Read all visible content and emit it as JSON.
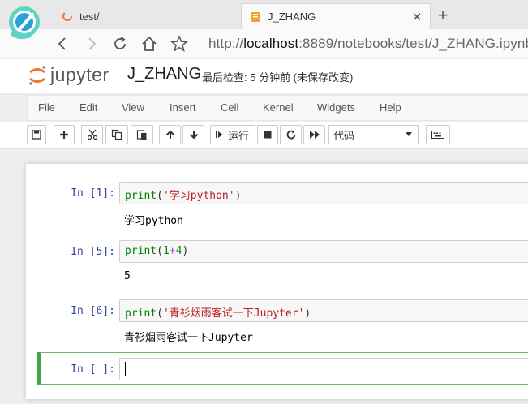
{
  "browser": {
    "tabs": [
      {
        "title": "test/",
        "active": false
      },
      {
        "title": "J_ZHANG",
        "active": true
      }
    ],
    "url": {
      "scheme": "http://",
      "host": "localhost",
      "rest": ":8889/notebooks/test/J_ZHANG.ipynb"
    }
  },
  "jupyter": {
    "logo_text": "jupyter",
    "notebook_name": "J_ZHANG",
    "checkpoint": "最后检查: 5 分钟前  (未保存改变)"
  },
  "menu": [
    "File",
    "Edit",
    "View",
    "Insert",
    "Cell",
    "Kernel",
    "Widgets",
    "Help"
  ],
  "toolbar": {
    "run_label": "运行",
    "cell_type": "代码"
  },
  "cells": [
    {
      "prompt": "In [1]:",
      "input": {
        "fn": "print",
        "open": "(",
        "arg": "'学习python'",
        "close": ")"
      },
      "output": "学习python"
    },
    {
      "prompt": "In [5]:",
      "input": {
        "fn": "print",
        "open": "(",
        "a": "1",
        "op": "+",
        "b": "4",
        "close": ")"
      },
      "output": "5"
    },
    {
      "prompt": "In [6]:",
      "input": {
        "fn": "print",
        "open": "(",
        "arg": "'青衫烟雨客试一下Jupyter'",
        "close": ")"
      },
      "output": "青衫烟雨客试一下Jupyter"
    },
    {
      "prompt": "In [ ]:",
      "input": "",
      "output": ""
    }
  ],
  "colors": {
    "prompt": "#303f9f",
    "keyword": "#008000",
    "string": "#ba2121",
    "active_cell_border": "#42a548",
    "jupyter_orange": "#f37626"
  }
}
